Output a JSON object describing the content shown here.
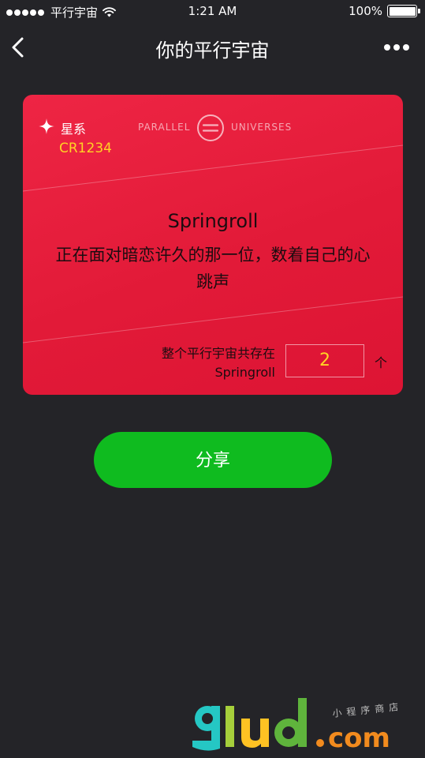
{
  "status_bar": {
    "carrier": "平行宇宙",
    "time": "1:21 AM",
    "battery": "100%"
  },
  "nav": {
    "title": "你的平行宇宙"
  },
  "card": {
    "galaxy_label": "星系",
    "galaxy_code": "CR1234",
    "logo_left": "PARALLEL",
    "logo_right": "UNIVERSES",
    "name": "Springroll",
    "description": "正在面对暗恋许久的那一位，数着自己的心跳声",
    "count_label_line1": "整个平行宇宙共存在",
    "count_label_line2": "Springroll",
    "count_value": "2",
    "count_unit": "个"
  },
  "share_label": "分享",
  "colors": {
    "background": "#242428",
    "card_red": "#e21a38",
    "accent_yellow": "#ffd324",
    "share_green": "#0fbb1f"
  }
}
